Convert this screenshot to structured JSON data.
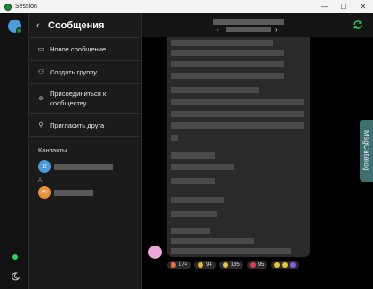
{
  "window": {
    "title": "Session",
    "minimize": "—",
    "maximize": "☐",
    "close": "✕"
  },
  "rail": {
    "avatar_initials": ""
  },
  "panel": {
    "title": "Сообщения",
    "menu": [
      {
        "label": "Новое сообщение",
        "icon": "message-icon"
      },
      {
        "label": "Создать группу",
        "icon": "group-icon"
      },
      {
        "label": "Присоединиться к сообществу",
        "icon": "globe-icon"
      },
      {
        "label": "Пригласить друга",
        "icon": "add-user-icon"
      }
    ],
    "contacts_label": "Контакты",
    "contacts": [
      {
        "initials": "12",
        "color": "#4b9be0"
      },
      {
        "section": "A"
      },
      {
        "initials": "AH",
        "color": "#e8913a"
      }
    ]
  },
  "conversation": {
    "side_tab": "MsgCatalog",
    "reactions": [
      {
        "emoji_color": "#e86a3a",
        "count": "174"
      },
      {
        "emoji_color": "#e8b43a",
        "count": "94"
      },
      {
        "emoji_color": "#e8c23a",
        "count": "185"
      },
      {
        "emoji_color": "#e23a4a",
        "count": "95"
      }
    ],
    "extra_emojis": [
      "#e8c23a",
      "#e8c23a",
      "#8a5ae8"
    ]
  },
  "colors": {
    "accent": "#1f8a3a",
    "online": "#2ed158",
    "refresh": "#2ed158"
  }
}
